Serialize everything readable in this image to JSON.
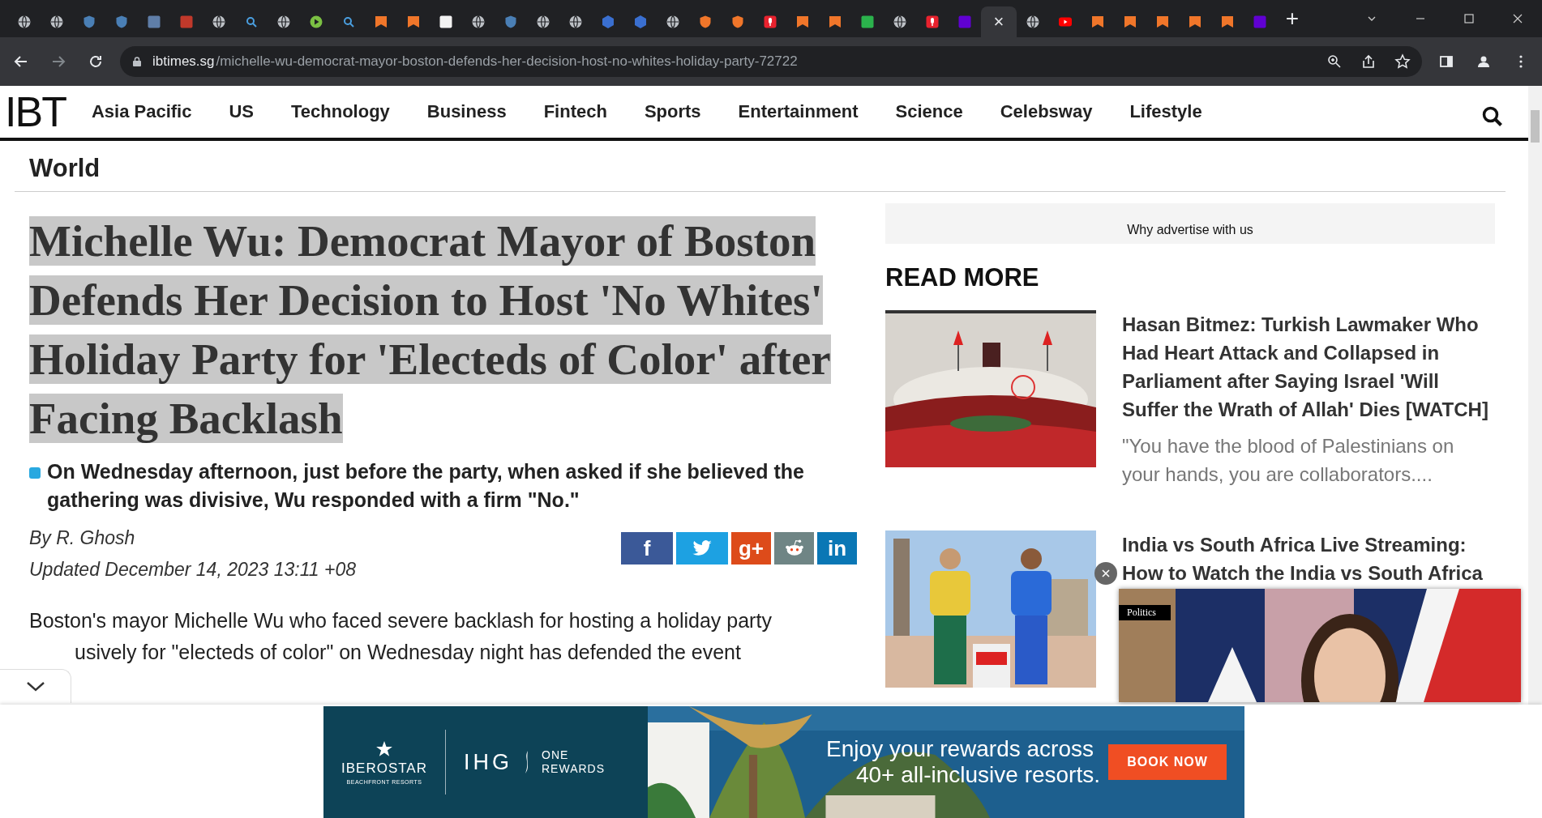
{
  "browser": {
    "tabs": [
      {
        "kind": "globe",
        "color": "#bdc1c6",
        "selected": false
      },
      {
        "kind": "globe",
        "color": "#bdc1c6",
        "selected": false
      },
      {
        "kind": "shield",
        "color": "#4a7fb5",
        "selected": false
      },
      {
        "kind": "shield",
        "color": "#4a7fb5",
        "selected": false
      },
      {
        "kind": "square",
        "color": "#5f7ea8",
        "selected": false
      },
      {
        "kind": "square",
        "color": "#c0392b",
        "selected": false
      },
      {
        "kind": "globe",
        "color": "#bdc1c6",
        "selected": false
      },
      {
        "kind": "search",
        "color": "#4a9fe0",
        "selected": false
      },
      {
        "kind": "globe",
        "color": "#bdc1c6",
        "selected": false
      },
      {
        "kind": "play",
        "color": "#7bc043",
        "selected": false
      },
      {
        "kind": "search",
        "color": "#4a9fe0",
        "selected": false
      },
      {
        "kind": "bookmark",
        "color": "#f0762a",
        "selected": false
      },
      {
        "kind": "bookmark",
        "color": "#f0762a",
        "selected": false
      },
      {
        "kind": "square",
        "color": "#f2f2f2",
        "selected": false
      },
      {
        "kind": "globe",
        "color": "#bdc1c6",
        "selected": false
      },
      {
        "kind": "shield",
        "color": "#4a7fb5",
        "selected": false
      },
      {
        "kind": "globe",
        "color": "#bdc1c6",
        "selected": false
      },
      {
        "kind": "globe",
        "color": "#bdc1c6",
        "selected": false
      },
      {
        "kind": "cube",
        "color": "#3a6fd0",
        "selected": false
      },
      {
        "kind": "cube",
        "color": "#3a6fd0",
        "selected": false
      },
      {
        "kind": "globe",
        "color": "#bdc1c6",
        "selected": false
      },
      {
        "kind": "shield",
        "color": "#f0762a",
        "selected": false
      },
      {
        "kind": "shield",
        "color": "#f0762a",
        "selected": false
      },
      {
        "kind": "mic",
        "color": "#e8222e",
        "selected": false
      },
      {
        "kind": "bookmark",
        "color": "#f0762a",
        "selected": false
      },
      {
        "kind": "bookmark",
        "color": "#f0762a",
        "selected": false
      },
      {
        "kind": "square",
        "color": "#2bb24c",
        "selected": false
      },
      {
        "kind": "globe",
        "color": "#bdc1c6",
        "selected": false
      },
      {
        "kind": "mic",
        "color": "#e8222e",
        "selected": false
      },
      {
        "kind": "square",
        "color": "#6001d2",
        "selected": false
      },
      {
        "close": "×",
        "selected": true
      },
      {
        "kind": "globe",
        "color": "#bdc1c6",
        "selected": false
      },
      {
        "kind": "video",
        "color": "#ff0000",
        "selected": false
      },
      {
        "kind": "bookmark",
        "color": "#f0762a",
        "selected": false
      },
      {
        "kind": "bookmark",
        "color": "#f0762a",
        "selected": false
      },
      {
        "kind": "bookmark",
        "color": "#f0762a",
        "selected": false
      },
      {
        "kind": "bookmark",
        "color": "#f0762a",
        "selected": false
      },
      {
        "kind": "bookmark",
        "color": "#f0762a",
        "selected": false
      },
      {
        "kind": "square",
        "color": "#6001d2",
        "selected": false
      }
    ],
    "new_tab": "+",
    "address": {
      "domain": "ibtimes.sg",
      "path": "/michelle-wu-democrat-mayor-boston-defends-her-decision-host-no-whites-holiday-party-72722"
    }
  },
  "site_nav": {
    "logo": "IBT",
    "items": [
      "Asia Pacific",
      "US",
      "Technology",
      "Business",
      "Fintech",
      "Sports",
      "Entertainment",
      "Science",
      "Celebsway",
      "Lifestyle"
    ]
  },
  "section": "World",
  "article": {
    "headline": "Michelle Wu: Democrat Mayor of Boston Defends Her Decision to Host 'No Whites' Holiday Party for 'Electeds of Color' after Facing Backlash",
    "headline_selected": true,
    "summary": "On Wednesday afternoon, just before the party, when asked if she believed the gathering was divisive, Wu responded with a firm \"No.\"",
    "byline": "By R. Ghosh",
    "updated": "Updated December 14, 2023 13:11 +08",
    "share": [
      {
        "kind": "facebook",
        "label": "f",
        "color": "#3b5998"
      },
      {
        "kind": "twitter",
        "color": "#1da1e2"
      },
      {
        "kind": "googleplus",
        "label": "g+",
        "color": "#dd4b1a"
      },
      {
        "kind": "reddit",
        "color": "#6f8585"
      },
      {
        "kind": "linkedin",
        "label": "in",
        "color": "#0a77b5"
      }
    ],
    "body_lines": [
      "Boston's mayor Michelle Wu who faced severe backlash for hosting a holiday party",
      "usively for \"electeds of color\" on Wednesday night has defended the event"
    ]
  },
  "sidebar": {
    "ad_link": "Why advertise with us",
    "heading": "READ MORE",
    "items": [
      {
        "kind": "parliament",
        "title": "Hasan Bitmez: Turkish Lawmaker Who Had Heart Attack and Collapsed in Parliament after Saying Israel 'Will Suffer the Wrath of Allah' Dies [WATCH]",
        "excerpt": "\"You have the blood of Palestinians on your hands, you are collaborators...."
      },
      {
        "kind": "cricket",
        "title": "India vs South Africa Live Streaming: How to Watch the India vs South Africa"
      }
    ]
  },
  "video_popup": {
    "tag": "Politics"
  },
  "bottom_ad": {
    "brand": "IBEROSTAR",
    "brand_sub": "BEACHFRONT RESORTS",
    "partner": "IHG",
    "partner_sub_1": "ONE",
    "partner_sub_2": "REWARDS",
    "headline_1": "Enjoy your rewards across",
    "headline_2": "40+ all-inclusive resorts.",
    "button": "BOOK NOW"
  }
}
